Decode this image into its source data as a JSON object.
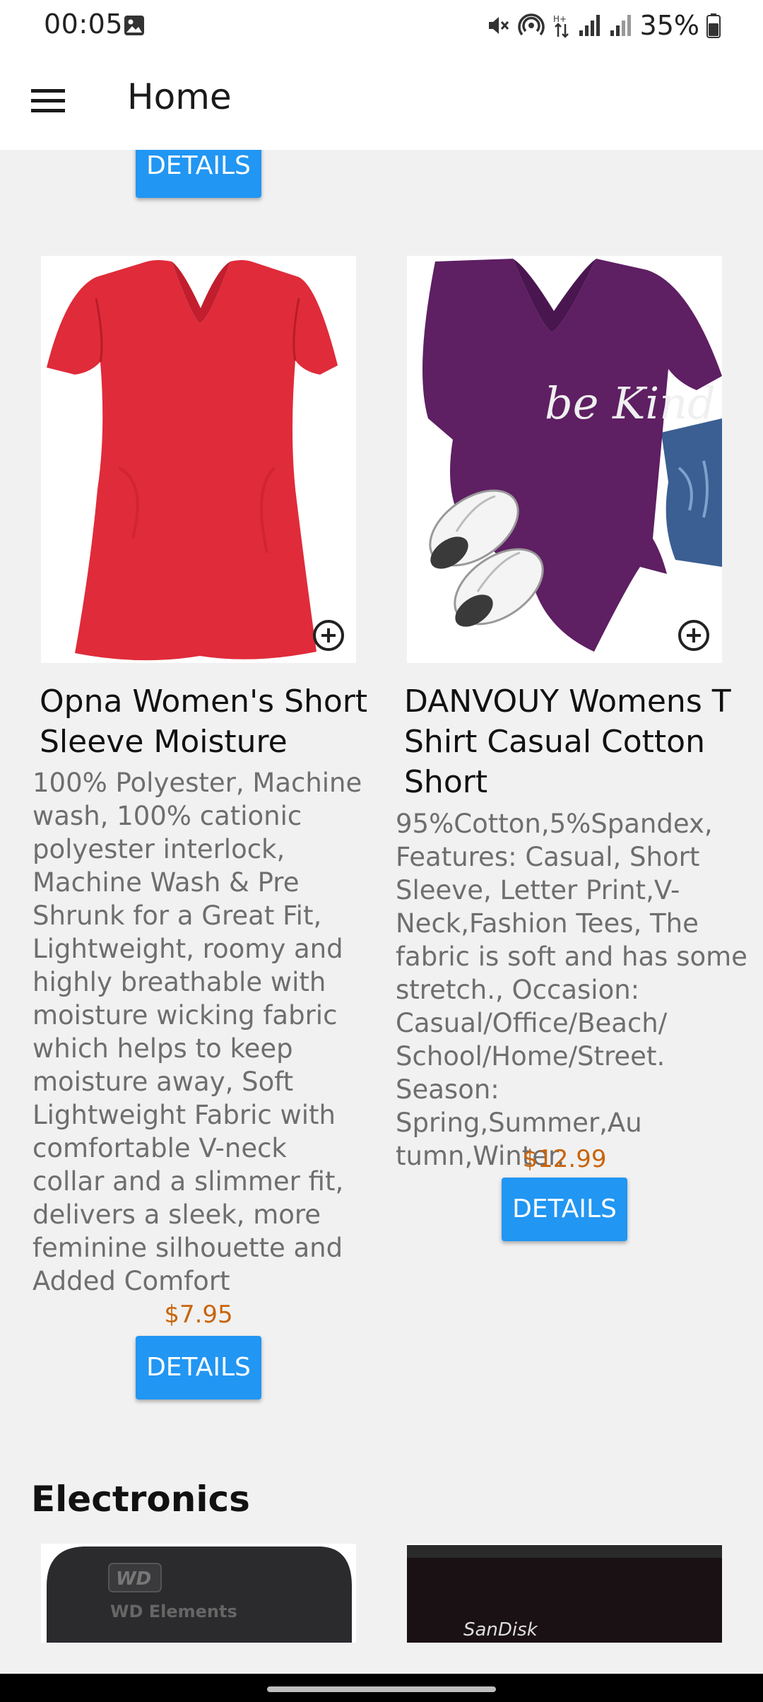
{
  "status_bar": {
    "time": "00:05",
    "battery": "35%",
    "icons": [
      "gallery-icon",
      "mute-icon",
      "hotspot-icon",
      "data-arrows-icon",
      "signal-icon",
      "signal-icon",
      "battery-icon"
    ]
  },
  "app_bar": {
    "title": "Home",
    "menu_icon": "hamburger-menu-icon"
  },
  "colors": {
    "accent": "#2196f3",
    "price": "#c8640a",
    "background": "#f1f1f1"
  },
  "top_partial": {
    "details_label": "DETAILS"
  },
  "products": [
    {
      "title": "Opna Women's Short Sleeve Moisture",
      "description": "100% Polyester, Machine wash, 100% cationic polyester interlock, Machine Wash & Pre Shrunk for a Great Fit, Lightweight, roomy and highly breathable with moisture wicking fabric which helps to keep moisture away, Soft Lightweight Fabric with comfortable V-neck collar and a slimmer fit, delivers a sleek, more feminine silhouette and Added Comfort",
      "price": "$7.95",
      "details_label": "DETAILS"
    },
    {
      "title": "DANVOUY Womens T Shirt Casual Cotton Short",
      "description": "95%Cotton,5%Spandex, Features: Casual, Short Sleeve, Letter Print,V-Neck,Fashion Tees, The fabric is soft and has some stretch., Occasion: Casual/Office/Beach/ School/Home/Street. Season: Spring,Summer,Au tumn,Winter.",
      "price": "$12.99",
      "details_label": "DETAILS",
      "image_text": "be Kind"
    }
  ],
  "electronics": {
    "section_title": "Electronics",
    "items": [
      {
        "image_text": "WD Elements"
      },
      {
        "image_text": "SanDisk"
      }
    ]
  }
}
